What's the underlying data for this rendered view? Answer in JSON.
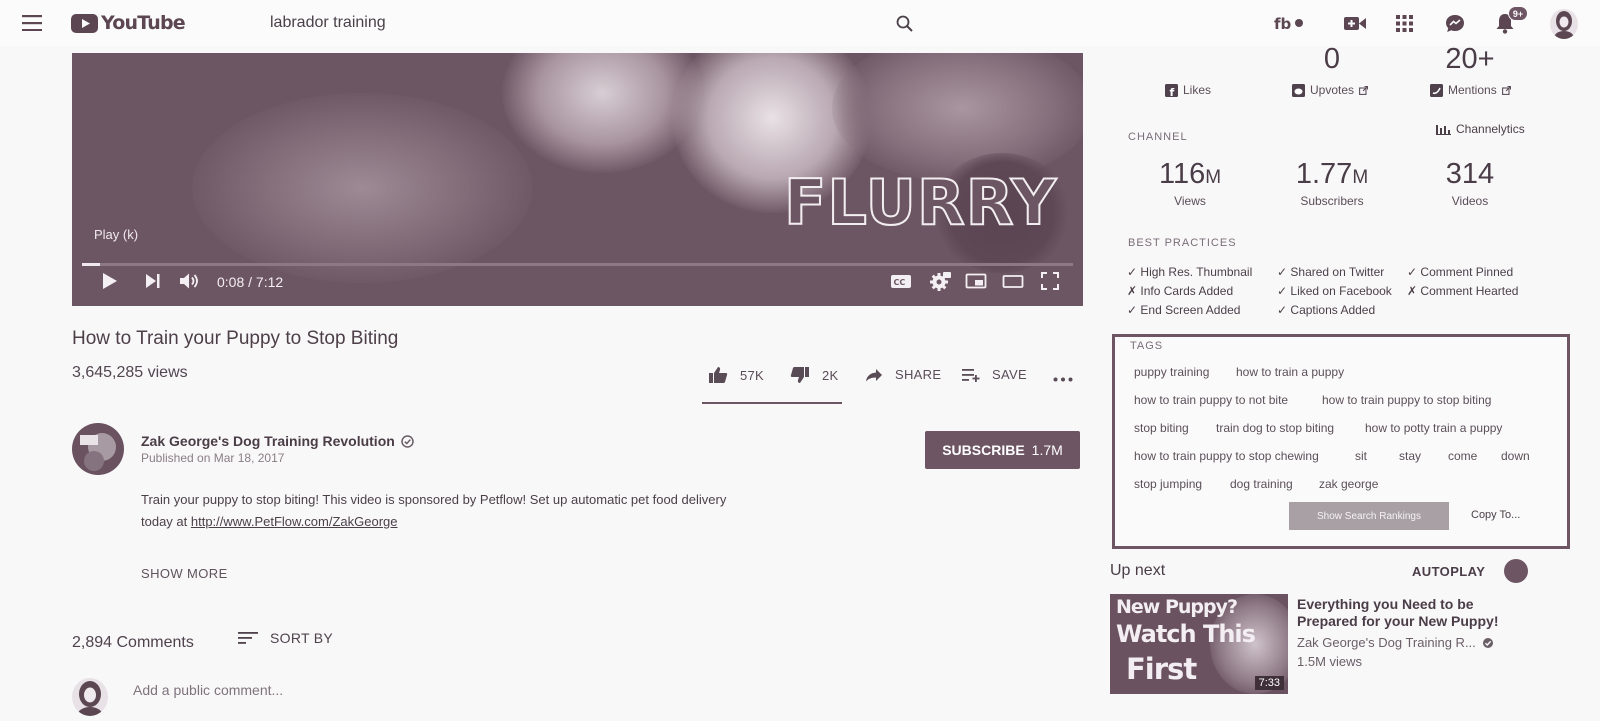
{
  "header": {
    "logo": "YouTube",
    "search_query": "labrador training",
    "notification_count": "9+"
  },
  "player": {
    "overlay_text": "FLURRY",
    "tooltip": "Play (k)",
    "time": "0:08 / 7:12",
    "progress": 0.0185
  },
  "video": {
    "title": "How to Train your Puppy to Stop Biting",
    "views": "3,645,285 views",
    "likes": "57K",
    "dislikes": "2K",
    "share_label": "SHARE",
    "save_label": "SAVE"
  },
  "channel": {
    "name": "Zak George's Dog Training Revolution",
    "published": "Published on Mar 18, 2017",
    "subscribe_label": "SUBSCRIBE",
    "subscriber_count": "1.7M"
  },
  "description": {
    "line1": "Train your puppy to stop biting! This video is sponsored by Petflow! Set up automatic pet food delivery",
    "line2_prefix": "today at ",
    "link": "http://www.PetFlow.com/ZakGeorge",
    "show_more": "SHOW MORE"
  },
  "comments": {
    "count": "2,894 Comments",
    "sort_label": "SORT BY",
    "placeholder": "Add a public comment..."
  },
  "stats": {
    "top": [
      {
        "value": "",
        "label": "Likes",
        "icon": "facebook-icon"
      },
      {
        "value": "0",
        "label": "Upvotes",
        "icon": "reddit-icon"
      },
      {
        "value": "20+",
        "label": "Mentions",
        "icon": "twitter-icon"
      }
    ],
    "channel_section": "CHANNEL",
    "channelytics": "Channelytics",
    "channel": [
      {
        "value": "116",
        "unit": "M",
        "label": "Views"
      },
      {
        "value": "1.77",
        "unit": "M",
        "label": "Subscribers"
      },
      {
        "value": "314",
        "unit": "",
        "label": "Videos"
      }
    ]
  },
  "best_practices": {
    "section": "BEST PRACTICES",
    "items": [
      [
        "✓",
        "High Res. Thumbnail"
      ],
      [
        "✓",
        "Shared on Twitter"
      ],
      [
        "✓",
        "Comment Pinned"
      ],
      [
        "✗",
        "Info Cards Added"
      ],
      [
        "✓",
        "Liked on Facebook"
      ],
      [
        "✗",
        "Comment Hearted"
      ],
      [
        "✓",
        "End Screen Added"
      ],
      [
        "✓",
        "Captions Added"
      ]
    ]
  },
  "tags": {
    "section": "TAGS",
    "items": [
      "puppy training",
      "how to train a puppy",
      "how to train puppy to not bite",
      "how to train puppy to stop biting",
      "stop biting",
      "train dog to stop biting",
      "how to potty train a puppy",
      "how to train puppy to stop chewing",
      "sit",
      "stay",
      "come",
      "down",
      "stop jumping",
      "dog training",
      "zak george"
    ],
    "rank_button": "Show Search Rankings",
    "copy_button": "Copy To..."
  },
  "up_next": {
    "label": "Up next",
    "autoplay": "AUTOPLAY",
    "video": {
      "thumb_line1": "New Puppy?",
      "thumb_line2": "Watch This",
      "thumb_line3": "First",
      "duration": "7:33",
      "title": "Everything you Need to be Prepared for your New Puppy!",
      "channel": "Zak George's Dog Training R...",
      "views": "1.5M views"
    }
  },
  "colors": {
    "accent": "#6e5563",
    "background": "#f9f8f9"
  }
}
